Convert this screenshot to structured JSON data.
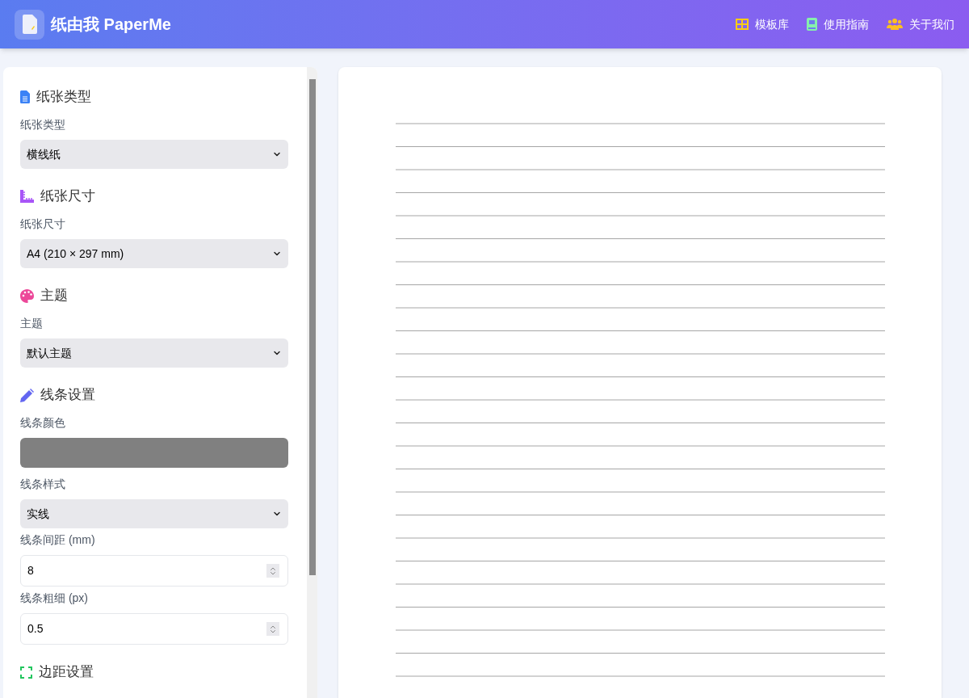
{
  "header": {
    "title": "纸由我 PaperMe",
    "nav": [
      {
        "label": "模板库"
      },
      {
        "label": "使用指南"
      },
      {
        "label": "关于我们"
      }
    ]
  },
  "sidebar": {
    "sections": [
      {
        "title": "纸张类型",
        "fields": [
          {
            "kind": "select",
            "label": "纸张类型",
            "value": "横线纸"
          }
        ]
      },
      {
        "title": "纸张尺寸",
        "fields": [
          {
            "kind": "select",
            "label": "纸张尺寸",
            "value": "A4 (210 × 297 mm)"
          }
        ]
      },
      {
        "title": "主题",
        "fields": [
          {
            "kind": "select",
            "label": "主题",
            "value": "默认主题"
          }
        ]
      },
      {
        "title": "线条设置",
        "fields": [
          {
            "kind": "color",
            "label": "线条颜色",
            "color": "#808080"
          },
          {
            "kind": "select",
            "label": "线条样式",
            "value": "实线"
          },
          {
            "kind": "number",
            "label": "线条间距 (mm)",
            "value": "8"
          },
          {
            "kind": "number",
            "label": "线条粗细 (px)",
            "value": "0.5"
          }
        ]
      },
      {
        "title": "边距设置"
      }
    ]
  }
}
